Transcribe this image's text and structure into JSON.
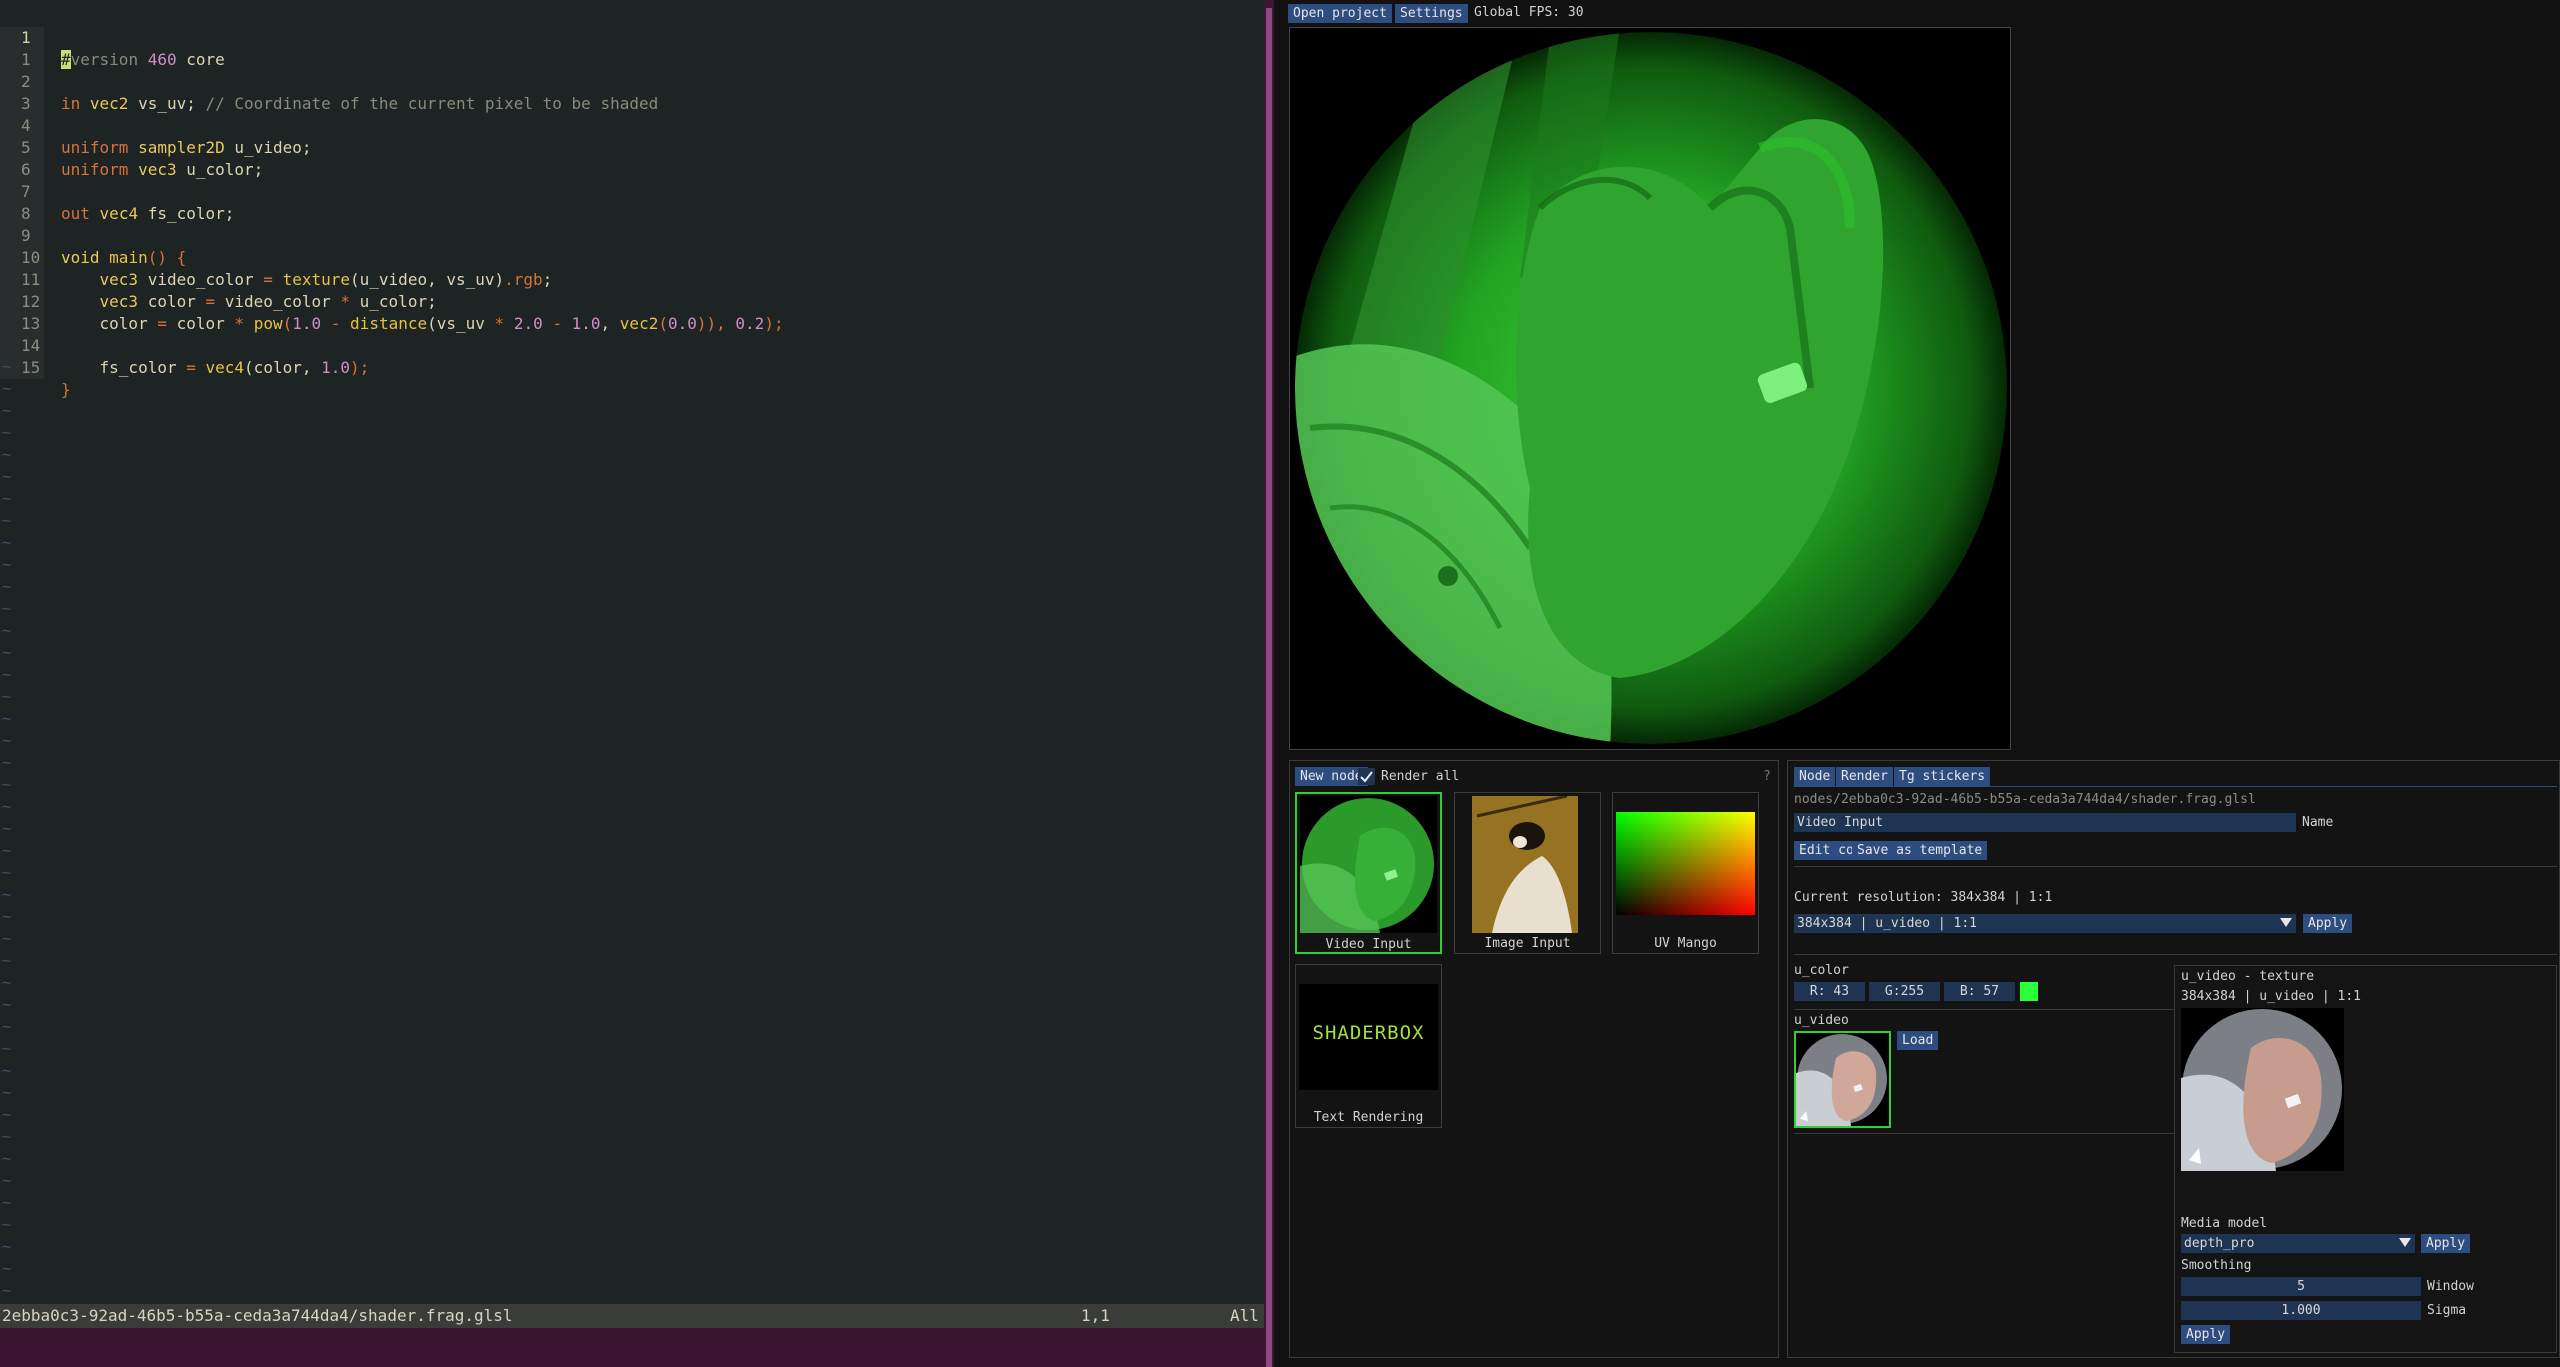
{
  "editor": {
    "lines": [
      {
        "n": "1"
      },
      {
        "n": "1"
      },
      {
        "n": "2"
      },
      {
        "n": "3"
      },
      {
        "n": "4"
      },
      {
        "n": "5"
      },
      {
        "n": "6"
      },
      {
        "n": "7"
      },
      {
        "n": "8"
      },
      {
        "n": "9"
      },
      {
        "n": "10"
      },
      {
        "n": "11"
      },
      {
        "n": "12"
      },
      {
        "n": "13"
      },
      {
        "n": "14"
      },
      {
        "n": "15"
      }
    ],
    "code": {
      "l1_cursor": "#",
      "l1_a": "version",
      "l1_b": " 460 ",
      "l1_c": "core",
      "l3_in": "in",
      "l3_type": "vec2",
      "l3_name": " vs_uv; ",
      "l3_comment": "// Coordinate of the current pixel to be shaded",
      "l5_uniform": "uniform",
      "l5_type": "sampler2D",
      "l5_name": " u_video;",
      "l6_uniform": "uniform",
      "l6_type": "vec3",
      "l6_name": " u_color;",
      "l8_out": "out",
      "l8_type": "vec4",
      "l8_name": " fs_color;",
      "l10_void": "void",
      "l10_main": "main",
      "l10_rest": "() {",
      "l11_type": "vec3",
      "l11_a": " video_color ",
      "l11_eq": "=",
      "l11_fn": "texture",
      "l11_args": "(u_video, vs_uv)",
      "l11_swz": ".rgb",
      "l11_end": ";",
      "l12_type": "vec3",
      "l12_a": " color ",
      "l12_eq": "=",
      "l12_b": " video_color ",
      "l12_mul": "*",
      "l12_c": " u_color;",
      "l13_a": "color ",
      "l13_eq": "=",
      "l13_b": " color ",
      "l13_mul": "*",
      "l13_pow": "pow",
      "l13_p1": "(",
      "l13_n1": "1.0",
      "l13_minus": " - ",
      "l13_dist": "distance",
      "l13_p2": "(vs_uv ",
      "l13_mul2": "*",
      "l13_n2": " 2.0 ",
      "l13_minus2": "-",
      "l13_n3": " 1.0",
      "l13_comma": ", ",
      "l13_vec2": "vec2",
      "l13_p3": "(",
      "l13_n4": "0.0",
      "l13_p4": ")), ",
      "l13_n5": "0.2",
      "l13_end": ");",
      "l15_a": "fs_color ",
      "l15_eq": "=",
      "l15_vec4": "vec4",
      "l15_p": "(color, ",
      "l15_n": "1.0",
      "l15_end": ");",
      "l16_brace": "}"
    },
    "tilde": "~",
    "status": {
      "file": "2ebba0c3-92ad-46b5-b55a-ceda3a744da4/shader.frag.glsl",
      "position": "1,1",
      "scroll": "All"
    }
  },
  "topbar": {
    "open_project": "Open project",
    "settings": "Settings",
    "fps": "Global FPS: 30"
  },
  "nodes_panel": {
    "new_node": "New node",
    "render_all": "Render all",
    "help": "?",
    "tiles": [
      {
        "caption": "Video Input"
      },
      {
        "caption": "Image Input"
      },
      {
        "caption": "UV Mango"
      },
      {
        "caption": "Text Rendering",
        "logo": "SHADERBOX"
      }
    ]
  },
  "inspector": {
    "tabs": [
      "Node",
      "Render",
      "Tg stickers"
    ],
    "path": "nodes/2ebba0c3-92ad-46b5-b55a-ceda3a744da4/shader.frag.glsl",
    "name_value": "Video Input",
    "name_label": "Name",
    "edit_code": "Edit code",
    "save_template": "Save as template",
    "current_resolution": "Current resolution: 384x384 | 1:1",
    "resolution_select": "384x384 | u_video | 1:1",
    "apply": "Apply",
    "u_color_label": "u_color",
    "r": "R: 43",
    "g": "G:255",
    "b": "B: 57",
    "swatch_color": "#2bff39",
    "u_video_label": "u_video",
    "load": "Load"
  },
  "texture_panel": {
    "title": "u_video - texture",
    "info": "384x384 | u_video | 1:1",
    "media_model_label": "Media model",
    "media_model_value": "depth_pro",
    "apply": "Apply",
    "smoothing_label": "Smoothing",
    "window_value": "5",
    "window_label": "Window",
    "sigma_value": "1.000",
    "sigma_label": "Sigma",
    "apply2": "Apply"
  }
}
